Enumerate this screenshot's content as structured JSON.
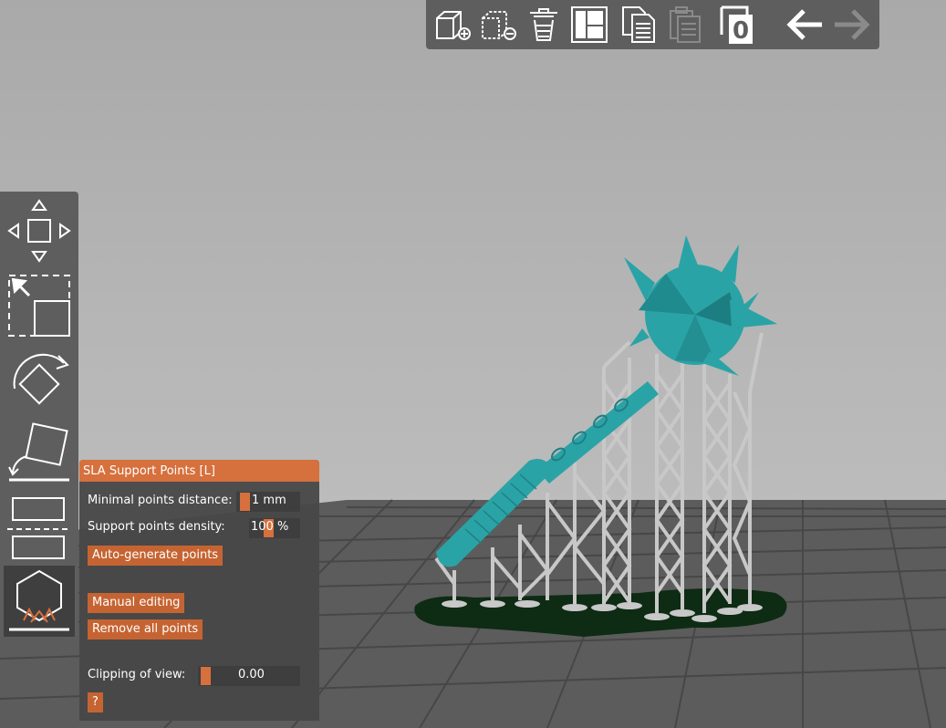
{
  "toolbar": {
    "icons": [
      "add-object-icon",
      "remove-object-icon",
      "delete-all-icon",
      "arrange-icon",
      "copy-icon",
      "paste-icon",
      "instances-icon",
      "undo-icon",
      "redo-icon"
    ],
    "instances_count": "0"
  },
  "left_toolbar": {
    "icons": [
      "move-icon",
      "scale-icon",
      "rotate-icon",
      "place-on-face-icon",
      "cut-icon",
      "sla-support-points-icon"
    ]
  },
  "panel": {
    "title": "SLA Support Points [L]",
    "min_distance_label": "Minimal points distance:",
    "min_distance_value": "1 mm",
    "density_label": "Support points density:",
    "density_value": "100 %",
    "auto_generate_label": "Auto-generate points",
    "manual_editing_label": "Manual editing",
    "remove_all_label": "Remove all points",
    "clipping_label": "Clipping of view:",
    "clipping_value": "0.00",
    "help_label": "?"
  },
  "colors": {
    "accent": "#d6703d",
    "model": "#2aa3a6",
    "supports": "#c8c8c8",
    "pad": "#0e2b14",
    "toolbar": "#5e5e5e"
  }
}
